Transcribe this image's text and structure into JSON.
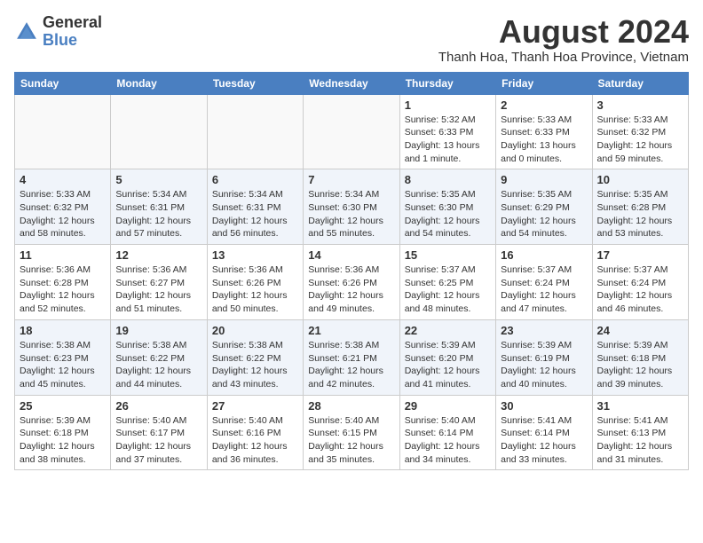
{
  "header": {
    "logo_general": "General",
    "logo_blue": "Blue",
    "month_year": "August 2024",
    "location": "Thanh Hoa, Thanh Hoa Province, Vietnam"
  },
  "days_of_week": [
    "Sunday",
    "Monday",
    "Tuesday",
    "Wednesday",
    "Thursday",
    "Friday",
    "Saturday"
  ],
  "weeks": [
    [
      {
        "day": "",
        "info": ""
      },
      {
        "day": "",
        "info": ""
      },
      {
        "day": "",
        "info": ""
      },
      {
        "day": "",
        "info": ""
      },
      {
        "day": "1",
        "info": "Sunrise: 5:32 AM\nSunset: 6:33 PM\nDaylight: 13 hours\nand 1 minute."
      },
      {
        "day": "2",
        "info": "Sunrise: 5:33 AM\nSunset: 6:33 PM\nDaylight: 13 hours\nand 0 minutes."
      },
      {
        "day": "3",
        "info": "Sunrise: 5:33 AM\nSunset: 6:32 PM\nDaylight: 12 hours\nand 59 minutes."
      }
    ],
    [
      {
        "day": "4",
        "info": "Sunrise: 5:33 AM\nSunset: 6:32 PM\nDaylight: 12 hours\nand 58 minutes."
      },
      {
        "day": "5",
        "info": "Sunrise: 5:34 AM\nSunset: 6:31 PM\nDaylight: 12 hours\nand 57 minutes."
      },
      {
        "day": "6",
        "info": "Sunrise: 5:34 AM\nSunset: 6:31 PM\nDaylight: 12 hours\nand 56 minutes."
      },
      {
        "day": "7",
        "info": "Sunrise: 5:34 AM\nSunset: 6:30 PM\nDaylight: 12 hours\nand 55 minutes."
      },
      {
        "day": "8",
        "info": "Sunrise: 5:35 AM\nSunset: 6:30 PM\nDaylight: 12 hours\nand 54 minutes."
      },
      {
        "day": "9",
        "info": "Sunrise: 5:35 AM\nSunset: 6:29 PM\nDaylight: 12 hours\nand 54 minutes."
      },
      {
        "day": "10",
        "info": "Sunrise: 5:35 AM\nSunset: 6:28 PM\nDaylight: 12 hours\nand 53 minutes."
      }
    ],
    [
      {
        "day": "11",
        "info": "Sunrise: 5:36 AM\nSunset: 6:28 PM\nDaylight: 12 hours\nand 52 minutes."
      },
      {
        "day": "12",
        "info": "Sunrise: 5:36 AM\nSunset: 6:27 PM\nDaylight: 12 hours\nand 51 minutes."
      },
      {
        "day": "13",
        "info": "Sunrise: 5:36 AM\nSunset: 6:26 PM\nDaylight: 12 hours\nand 50 minutes."
      },
      {
        "day": "14",
        "info": "Sunrise: 5:36 AM\nSunset: 6:26 PM\nDaylight: 12 hours\nand 49 minutes."
      },
      {
        "day": "15",
        "info": "Sunrise: 5:37 AM\nSunset: 6:25 PM\nDaylight: 12 hours\nand 48 minutes."
      },
      {
        "day": "16",
        "info": "Sunrise: 5:37 AM\nSunset: 6:24 PM\nDaylight: 12 hours\nand 47 minutes."
      },
      {
        "day": "17",
        "info": "Sunrise: 5:37 AM\nSunset: 6:24 PM\nDaylight: 12 hours\nand 46 minutes."
      }
    ],
    [
      {
        "day": "18",
        "info": "Sunrise: 5:38 AM\nSunset: 6:23 PM\nDaylight: 12 hours\nand 45 minutes."
      },
      {
        "day": "19",
        "info": "Sunrise: 5:38 AM\nSunset: 6:22 PM\nDaylight: 12 hours\nand 44 minutes."
      },
      {
        "day": "20",
        "info": "Sunrise: 5:38 AM\nSunset: 6:22 PM\nDaylight: 12 hours\nand 43 minutes."
      },
      {
        "day": "21",
        "info": "Sunrise: 5:38 AM\nSunset: 6:21 PM\nDaylight: 12 hours\nand 42 minutes."
      },
      {
        "day": "22",
        "info": "Sunrise: 5:39 AM\nSunset: 6:20 PM\nDaylight: 12 hours\nand 41 minutes."
      },
      {
        "day": "23",
        "info": "Sunrise: 5:39 AM\nSunset: 6:19 PM\nDaylight: 12 hours\nand 40 minutes."
      },
      {
        "day": "24",
        "info": "Sunrise: 5:39 AM\nSunset: 6:18 PM\nDaylight: 12 hours\nand 39 minutes."
      }
    ],
    [
      {
        "day": "25",
        "info": "Sunrise: 5:39 AM\nSunset: 6:18 PM\nDaylight: 12 hours\nand 38 minutes."
      },
      {
        "day": "26",
        "info": "Sunrise: 5:40 AM\nSunset: 6:17 PM\nDaylight: 12 hours\nand 37 minutes."
      },
      {
        "day": "27",
        "info": "Sunrise: 5:40 AM\nSunset: 6:16 PM\nDaylight: 12 hours\nand 36 minutes."
      },
      {
        "day": "28",
        "info": "Sunrise: 5:40 AM\nSunset: 6:15 PM\nDaylight: 12 hours\nand 35 minutes."
      },
      {
        "day": "29",
        "info": "Sunrise: 5:40 AM\nSunset: 6:14 PM\nDaylight: 12 hours\nand 34 minutes."
      },
      {
        "day": "30",
        "info": "Sunrise: 5:41 AM\nSunset: 6:14 PM\nDaylight: 12 hours\nand 33 minutes."
      },
      {
        "day": "31",
        "info": "Sunrise: 5:41 AM\nSunset: 6:13 PM\nDaylight: 12 hours\nand 31 minutes."
      }
    ]
  ]
}
